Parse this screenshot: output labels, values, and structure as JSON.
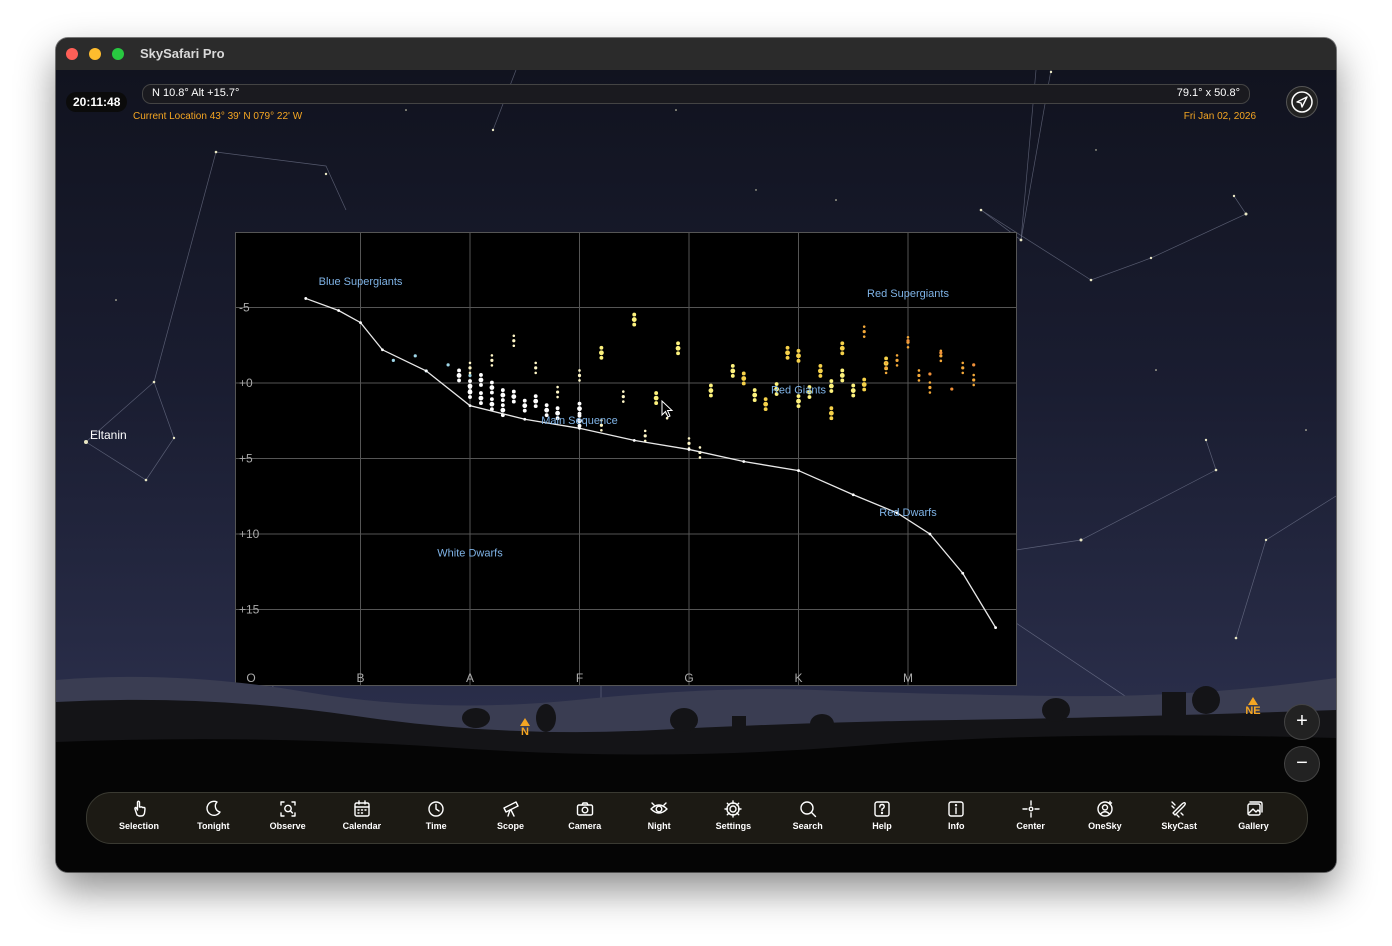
{
  "window": {
    "title": "SkySafari Pro"
  },
  "status": {
    "clock": "20:11:48",
    "position": "N 10.8° Alt +15.7°",
    "fov": "79.1° x 50.8°",
    "location": "Current Location  43° 39' N 079° 22' W",
    "date": "Fri Jan 02, 2026"
  },
  "sky_labels": {
    "star": "Eltanin",
    "compass_n": "N",
    "compass_ne": "NE"
  },
  "zoom": {
    "in": "+",
    "out": "−"
  },
  "toolbar": [
    {
      "label": "Selection",
      "icon": "hand-pointer-icon"
    },
    {
      "label": "Tonight",
      "icon": "moon-icon"
    },
    {
      "label": "Observe",
      "icon": "observe-icon"
    },
    {
      "label": "Calendar",
      "icon": "calendar-icon"
    },
    {
      "label": "Time",
      "icon": "clock-icon"
    },
    {
      "label": "Scope",
      "icon": "telescope-icon"
    },
    {
      "label": "Camera",
      "icon": "camera-icon"
    },
    {
      "label": "Night",
      "icon": "eye-icon"
    },
    {
      "label": "Settings",
      "icon": "gear-icon"
    },
    {
      "label": "Search",
      "icon": "search-icon"
    },
    {
      "label": "Help",
      "icon": "help-icon"
    },
    {
      "label": "Info",
      "icon": "info-icon"
    },
    {
      "label": "Center",
      "icon": "crosshair-icon"
    },
    {
      "label": "OneSky",
      "icon": "onesky-icon"
    },
    {
      "label": "SkyCast",
      "icon": "skycast-icon"
    },
    {
      "label": "Gallery",
      "icon": "gallery-icon"
    }
  ],
  "chart_data": {
    "type": "scatter",
    "title": "",
    "xlabel": "",
    "ylabel": "",
    "x_categories": [
      "O",
      "B",
      "A",
      "F",
      "G",
      "K",
      "M"
    ],
    "y_ticks": [
      "-5",
      "+0",
      "+5",
      "+10",
      "+15"
    ],
    "y_tick_values": [
      -5,
      0,
      5,
      10,
      15
    ],
    "ylim": [
      -10,
      20
    ],
    "y_inverted": true,
    "grid": true,
    "region_labels": [
      {
        "text": "Blue Supergiants",
        "x": 1.0,
        "y": -6.5
      },
      {
        "text": "Red Supergiants",
        "x": 6.0,
        "y": -5.7
      },
      {
        "text": "Red Giants",
        "x": 5.0,
        "y": 0.7
      },
      {
        "text": "Main Sequence",
        "x": 3.0,
        "y": 2.7
      },
      {
        "text": "Red Dwarfs",
        "x": 6.0,
        "y": 8.8
      },
      {
        "text": "White Dwarfs",
        "x": 2.0,
        "y": 11.5
      }
    ],
    "main_sequence_curve": {
      "x": [
        0.5,
        0.8,
        1.0,
        1.2,
        1.6,
        2.0,
        2.5,
        3.0,
        3.5,
        4.0,
        4.5,
        5.0,
        5.5,
        5.9,
        6.2,
        6.5,
        6.8
      ],
      "y": [
        -5.6,
        -4.8,
        -4.0,
        -2.2,
        -0.8,
        1.5,
        2.4,
        3.0,
        3.8,
        4.4,
        5.2,
        5.8,
        7.4,
        8.6,
        10.0,
        12.6,
        16.2
      ]
    },
    "series": [
      {
        "name": "",
        "color": "#9fd6e8",
        "x": [
          1.3,
          1.5,
          1.6,
          1.8,
          2.0
        ],
        "y": [
          -1.5,
          -1.8,
          -0.8,
          -1.2,
          -0.5
        ]
      },
      {
        "name": "",
        "color": "#ffffff",
        "x": [
          1.9,
          2.0,
          2.0,
          2.1,
          2.1,
          2.2,
          2.2,
          2.3,
          2.3,
          2.4,
          2.5,
          2.6,
          2.7,
          2.8,
          3.0,
          3.0
        ],
        "y": [
          -0.5,
          0.2,
          0.6,
          -0.2,
          1.0,
          0.3,
          1.4,
          0.8,
          1.8,
          0.9,
          1.5,
          1.2,
          1.8,
          2.0,
          1.7,
          2.5
        ]
      },
      {
        "name": "",
        "color": "#fff7c7",
        "x": [
          2.0,
          2.2,
          2.4,
          2.6,
          2.8,
          3.0,
          3.2,
          3.4,
          3.6,
          3.8,
          4.0,
          4.1
        ],
        "y": [
          -1.0,
          -1.5,
          -2.8,
          -1.0,
          0.6,
          -0.5,
          2.8,
          0.9,
          3.5,
          2.0,
          4.0,
          4.6
        ]
      },
      {
        "name": "",
        "color": "#fdf27d",
        "x": [
          3.2,
          3.5,
          3.7,
          3.9,
          4.2,
          4.4,
          4.6,
          4.8,
          5.0,
          5.1,
          5.3,
          5.4,
          5.5
        ],
        "y": [
          -2.0,
          -4.2,
          1.0,
          -2.3,
          0.5,
          -0.8,
          0.8,
          0.4,
          1.2,
          0.6,
          0.2,
          -0.5,
          0.5
        ]
      },
      {
        "name": "",
        "color": "#f6d24a",
        "x": [
          4.5,
          4.7,
          4.9,
          5.0,
          5.2,
          5.3,
          5.4,
          5.6,
          5.8
        ],
        "y": [
          -0.3,
          1.4,
          -2.0,
          -1.8,
          -0.8,
          2.0,
          -2.3,
          0.1,
          -1.3
        ]
      },
      {
        "name": "",
        "color": "#f4a93a",
        "x": [
          5.6,
          5.8,
          5.9,
          6.0,
          6.1,
          6.2,
          6.3,
          6.5,
          6.6
        ],
        "y": [
          -3.4,
          -1.0,
          -1.5,
          -2.7,
          -0.5,
          0.3,
          -1.8,
          -1.0,
          -0.2
        ]
      },
      {
        "name": "",
        "color": "#f0903a",
        "x": [
          6.0,
          6.2,
          6.3,
          6.4,
          6.6
        ],
        "y": [
          -2.8,
          -0.6,
          -2.0,
          0.4,
          -1.2
        ]
      }
    ]
  }
}
